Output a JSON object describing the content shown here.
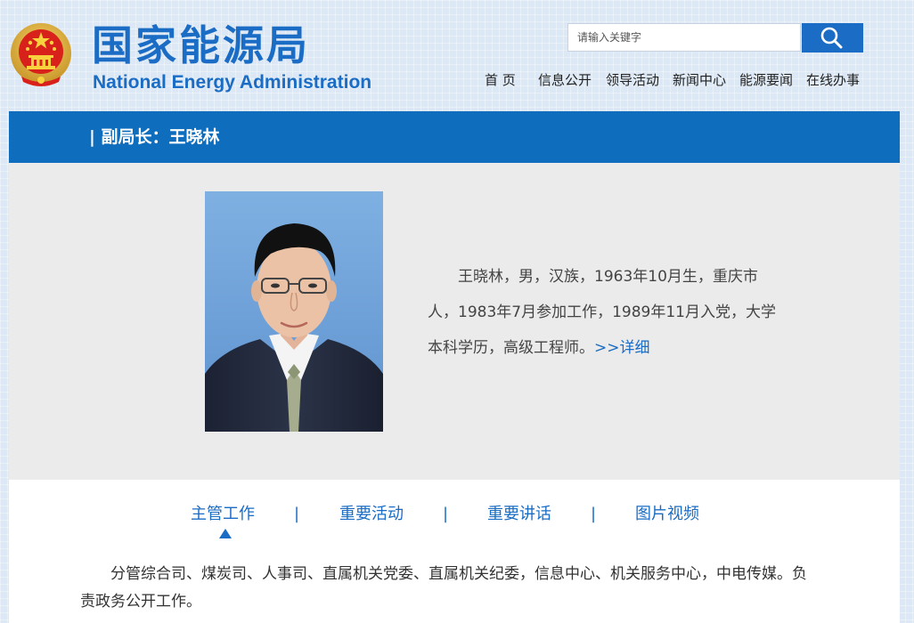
{
  "header": {
    "logo_cn": "国家能源局",
    "logo_en": "National Energy Administration",
    "search": {
      "placeholder": "请输入关键字"
    },
    "nav": [
      "首 页",
      "信息公开",
      "领导活动",
      "新闻中心",
      "能源要闻",
      "在线办事"
    ]
  },
  "profile": {
    "title": "| 副局长：王晓林",
    "bio": "王晓林，男，汉族，1963年10月生，重庆市人，1983年7月参加工作，1989年11月入党，大学本科学历，高级工程师。",
    "detail_link": ">>详细"
  },
  "tabs": {
    "items": [
      "主管工作",
      "重要活动",
      "重要讲话",
      "图片视频"
    ],
    "separator": "|",
    "active": "主管工作"
  },
  "duties": "分管综合司、煤炭司、人事司、直属机关党委、直属机关纪委，信息中心、机关服务中心，中电传媒。负责政务公开工作。",
  "colors": {
    "brand_blue": "#1a6cc4",
    "title_bar": "#0e6ebd",
    "profile_bg": "#ebebeb"
  }
}
